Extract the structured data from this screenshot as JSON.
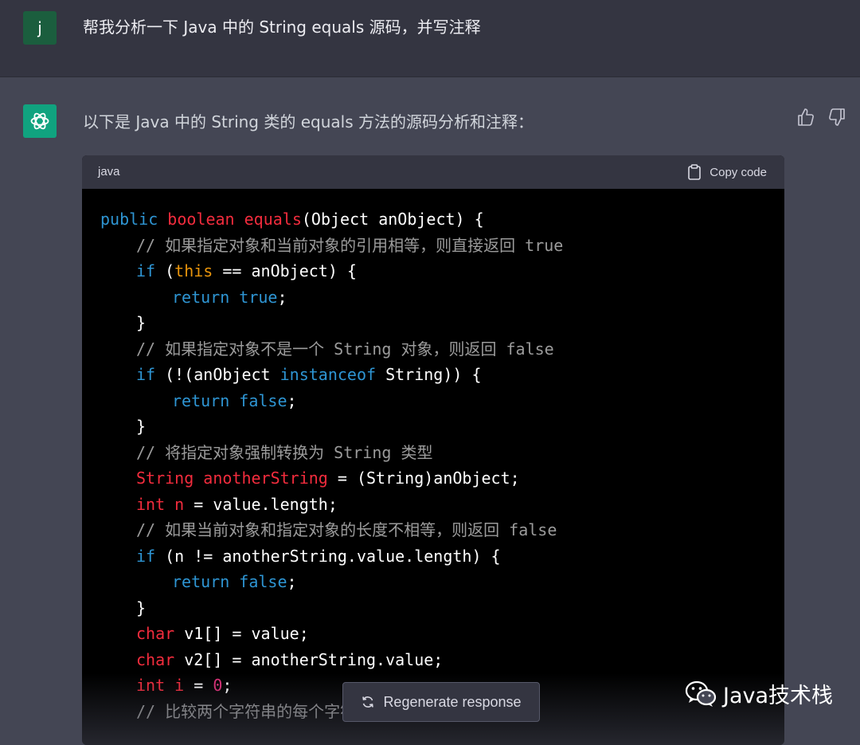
{
  "user_message": {
    "avatar_letter": "j",
    "text": "帮我分析一下 Java 中的 String equals 源码，并写注释"
  },
  "assistant_message": {
    "intro": "以下是 Java 中的 String 类的 equals 方法的源码分析和注释：",
    "thumbs_up_icon": "thumbs-up-icon",
    "thumbs_down_icon": "thumbs-down-icon"
  },
  "code_block": {
    "language": "java",
    "copy_label": "Copy code",
    "lines": [
      {
        "indent": 0,
        "tokens": [
          [
            "keyword",
            "public "
          ],
          [
            "type",
            "boolean "
          ],
          [
            "type",
            "equals"
          ],
          [
            "plain",
            "(Object anObject) {"
          ]
        ]
      },
      {
        "indent": 1,
        "tokens": [
          [
            "comment",
            "// 如果指定对象和当前对象的引用相等，则直接返回 true"
          ]
        ]
      },
      {
        "indent": 1,
        "tokens": [
          [
            "keyword",
            "if "
          ],
          [
            "plain",
            "("
          ],
          [
            "builtin",
            "this"
          ],
          [
            "plain",
            " == anObject) {"
          ]
        ]
      },
      {
        "indent": 2,
        "tokens": [
          [
            "keyword",
            "return "
          ],
          [
            "keyword",
            "true"
          ],
          [
            "plain",
            ";"
          ]
        ]
      },
      {
        "indent": 1,
        "tokens": [
          [
            "plain",
            "}"
          ]
        ]
      },
      {
        "indent": 1,
        "tokens": [
          [
            "comment",
            "// 如果指定对象不是一个 String 对象，则返回 false"
          ]
        ]
      },
      {
        "indent": 1,
        "tokens": [
          [
            "keyword",
            "if "
          ],
          [
            "plain",
            "(!(anObject "
          ],
          [
            "keyword",
            "instanceof"
          ],
          [
            "plain",
            " String)) {"
          ]
        ]
      },
      {
        "indent": 2,
        "tokens": [
          [
            "keyword",
            "return "
          ],
          [
            "keyword",
            "false"
          ],
          [
            "plain",
            ";"
          ]
        ]
      },
      {
        "indent": 1,
        "tokens": [
          [
            "plain",
            "}"
          ]
        ]
      },
      {
        "indent": 1,
        "tokens": [
          [
            "comment",
            "// 将指定对象强制转换为 String 类型"
          ]
        ]
      },
      {
        "indent": 1,
        "tokens": [
          [
            "type",
            "String "
          ],
          [
            "type",
            "anotherString"
          ],
          [
            "plain",
            " = (String)anObject;"
          ]
        ]
      },
      {
        "indent": 1,
        "tokens": [
          [
            "type",
            "int "
          ],
          [
            "type",
            "n"
          ],
          [
            "plain",
            " = value.length;"
          ]
        ]
      },
      {
        "indent": 1,
        "tokens": [
          [
            "comment",
            "// 如果当前对象和指定对象的长度不相等，则返回 false"
          ]
        ]
      },
      {
        "indent": 1,
        "tokens": [
          [
            "keyword",
            "if "
          ],
          [
            "plain",
            "(n != anotherString.value.length) {"
          ]
        ]
      },
      {
        "indent": 2,
        "tokens": [
          [
            "keyword",
            "return "
          ],
          [
            "keyword",
            "false"
          ],
          [
            "plain",
            ";"
          ]
        ]
      },
      {
        "indent": 1,
        "tokens": [
          [
            "plain",
            "}"
          ]
        ]
      },
      {
        "indent": 1,
        "tokens": [
          [
            "type",
            "char "
          ],
          [
            "plain",
            "v1[] = value;"
          ]
        ]
      },
      {
        "indent": 1,
        "tokens": [
          [
            "type",
            "char "
          ],
          [
            "plain",
            "v2[] = anotherString.value;"
          ]
        ]
      },
      {
        "indent": 1,
        "tokens": [
          [
            "type",
            "int "
          ],
          [
            "type",
            "i"
          ],
          [
            "plain",
            " = "
          ],
          [
            "number",
            "0"
          ],
          [
            "plain",
            ";"
          ]
        ]
      },
      {
        "indent": 1,
        "tokens": [
          [
            "comment",
            "// 比较两个字符串的每个字符"
          ]
        ]
      }
    ]
  },
  "regenerate_button": {
    "label": "Regenerate response",
    "icon": "refresh-icon"
  },
  "watermark": {
    "text": "Java技术栈",
    "icon": "wechat-icon"
  },
  "colors": {
    "user_bg": "#343541",
    "assistant_bg": "#444654",
    "code_bg": "#000000",
    "gpt_avatar": "#10a37f",
    "keyword": "#2e95d3",
    "type": "#f22c3d",
    "builtin": "#e9950c",
    "comment": "#9b9b9b"
  }
}
